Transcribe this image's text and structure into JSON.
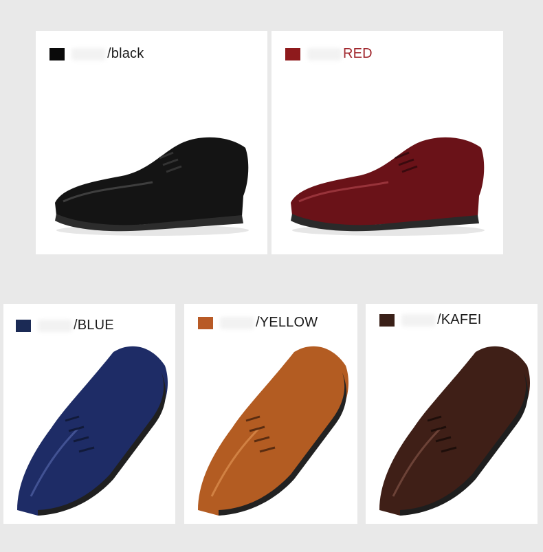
{
  "products": [
    {
      "label": "/black",
      "swatch": "#0a0a0a",
      "upper": "#141414",
      "highlight": "#5a5a5a",
      "text_color": "#1a1a1a"
    },
    {
      "label": "RED",
      "swatch": "#8e1a1c",
      "upper": "#6a1218",
      "highlight": "#b84a52",
      "text_color": "#a0262c"
    },
    {
      "label": "/BLUE",
      "swatch": "#1b2a55",
      "upper": "#1e2c66",
      "highlight": "#5a6cb0",
      "text_color": "#1a1a1a"
    },
    {
      "label": "/YELLOW",
      "swatch": "#b85a26",
      "upper": "#b35c22",
      "highlight": "#e59a5a",
      "text_color": "#1a1a1a"
    },
    {
      "label": "/KAFEI",
      "swatch": "#3a2018",
      "upper": "#3f1f17",
      "highlight": "#8a5a4c",
      "text_color": "#1a1a1a"
    }
  ]
}
